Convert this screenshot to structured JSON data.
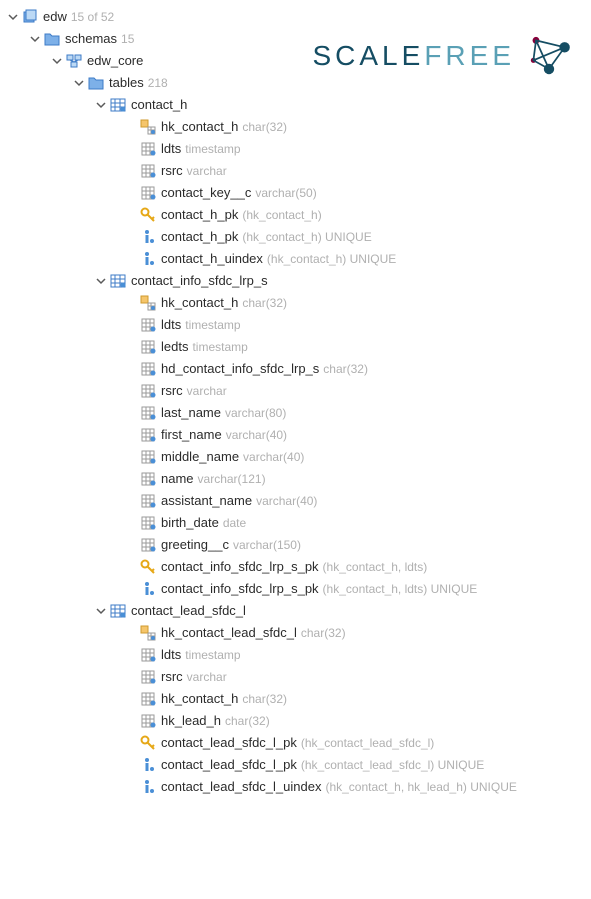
{
  "logo": {
    "text1": "SCALE",
    "text2": "FREE"
  },
  "root": {
    "name": "edw",
    "count": "15 of 52",
    "schemas": {
      "label": "schemas",
      "count": "15",
      "edw_core": {
        "label": "edw_core",
        "tables": {
          "label": "tables",
          "count": "218",
          "items": [
            {
              "name": "contact_h",
              "cols": [
                {
                  "icon": "fk",
                  "name": "hk_contact_h",
                  "type": "char(32)"
                },
                {
                  "icon": "col",
                  "name": "ldts",
                  "type": "timestamp"
                },
                {
                  "icon": "col",
                  "name": "rsrc",
                  "type": "varchar"
                },
                {
                  "icon": "col",
                  "name": "contact_key__c",
                  "type": "varchar(50)"
                },
                {
                  "icon": "key",
                  "name": "contact_h_pk",
                  "type": "(hk_contact_h)"
                },
                {
                  "icon": "info",
                  "name": "contact_h_pk",
                  "type": "(hk_contact_h) UNIQUE"
                },
                {
                  "icon": "info",
                  "name": "contact_h_uindex",
                  "type": "(hk_contact_h) UNIQUE"
                }
              ]
            },
            {
              "name": "contact_info_sfdc_lrp_s",
              "cols": [
                {
                  "icon": "fk",
                  "name": "hk_contact_h",
                  "type": "char(32)"
                },
                {
                  "icon": "col",
                  "name": "ldts",
                  "type": "timestamp"
                },
                {
                  "icon": "col",
                  "name": "ledts",
                  "type": "timestamp"
                },
                {
                  "icon": "col",
                  "name": "hd_contact_info_sfdc_lrp_s",
                  "type": "char(32)"
                },
                {
                  "icon": "col",
                  "name": "rsrc",
                  "type": "varchar"
                },
                {
                  "icon": "col",
                  "name": "last_name",
                  "type": "varchar(80)"
                },
                {
                  "icon": "col",
                  "name": "first_name",
                  "type": "varchar(40)"
                },
                {
                  "icon": "col",
                  "name": "middle_name",
                  "type": "varchar(40)"
                },
                {
                  "icon": "col",
                  "name": "name",
                  "type": "varchar(121)"
                },
                {
                  "icon": "col",
                  "name": "assistant_name",
                  "type": "varchar(40)"
                },
                {
                  "icon": "col",
                  "name": "birth_date",
                  "type": "date"
                },
                {
                  "icon": "col",
                  "name": "greeting__c",
                  "type": "varchar(150)"
                },
                {
                  "icon": "key",
                  "name": "contact_info_sfdc_lrp_s_pk",
                  "type": "(hk_contact_h, ldts)"
                },
                {
                  "icon": "info",
                  "name": "contact_info_sfdc_lrp_s_pk",
                  "type": "(hk_contact_h, ldts) UNIQUE"
                }
              ]
            },
            {
              "name": "contact_lead_sfdc_l",
              "cols": [
                {
                  "icon": "fk",
                  "name": "hk_contact_lead_sfdc_l",
                  "type": "char(32)"
                },
                {
                  "icon": "col",
                  "name": "ldts",
                  "type": "timestamp"
                },
                {
                  "icon": "col",
                  "name": "rsrc",
                  "type": "varchar"
                },
                {
                  "icon": "col",
                  "name": "hk_contact_h",
                  "type": "char(32)"
                },
                {
                  "icon": "col",
                  "name": "hk_lead_h",
                  "type": "char(32)"
                },
                {
                  "icon": "key",
                  "name": "contact_lead_sfdc_l_pk",
                  "type": "(hk_contact_lead_sfdc_l)"
                },
                {
                  "icon": "info",
                  "name": "contact_lead_sfdc_l_pk",
                  "type": "(hk_contact_lead_sfdc_l) UNIQUE"
                },
                {
                  "icon": "info",
                  "name": "contact_lead_sfdc_l_uindex",
                  "type": "(hk_contact_h, hk_lead_h) UNIQUE"
                }
              ]
            }
          ]
        }
      }
    }
  }
}
